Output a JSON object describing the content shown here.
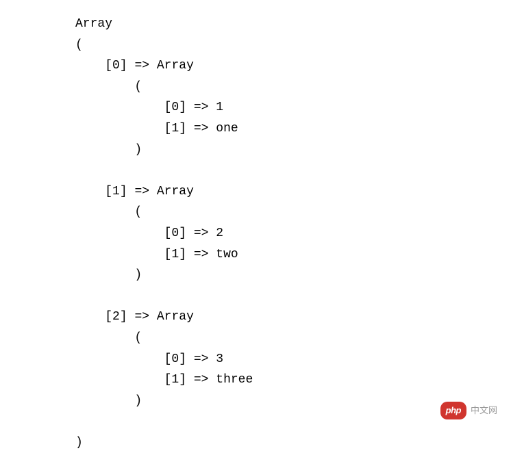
{
  "output": {
    "root_type": "Array",
    "items": [
      {
        "key": "[0]",
        "type": "Array",
        "children": [
          {
            "key": "[0]",
            "value": "1"
          },
          {
            "key": "[1]",
            "value": "one"
          }
        ]
      },
      {
        "key": "[1]",
        "type": "Array",
        "children": [
          {
            "key": "[0]",
            "value": "2"
          },
          {
            "key": "[1]",
            "value": "two"
          }
        ]
      },
      {
        "key": "[2]",
        "type": "Array",
        "children": [
          {
            "key": "[0]",
            "value": "3"
          },
          {
            "key": "[1]",
            "value": "three"
          }
        ]
      }
    ]
  },
  "arrow": "=>",
  "paren_open": "(",
  "paren_close": ")",
  "watermark": {
    "badge": "php",
    "text": "中文网"
  }
}
